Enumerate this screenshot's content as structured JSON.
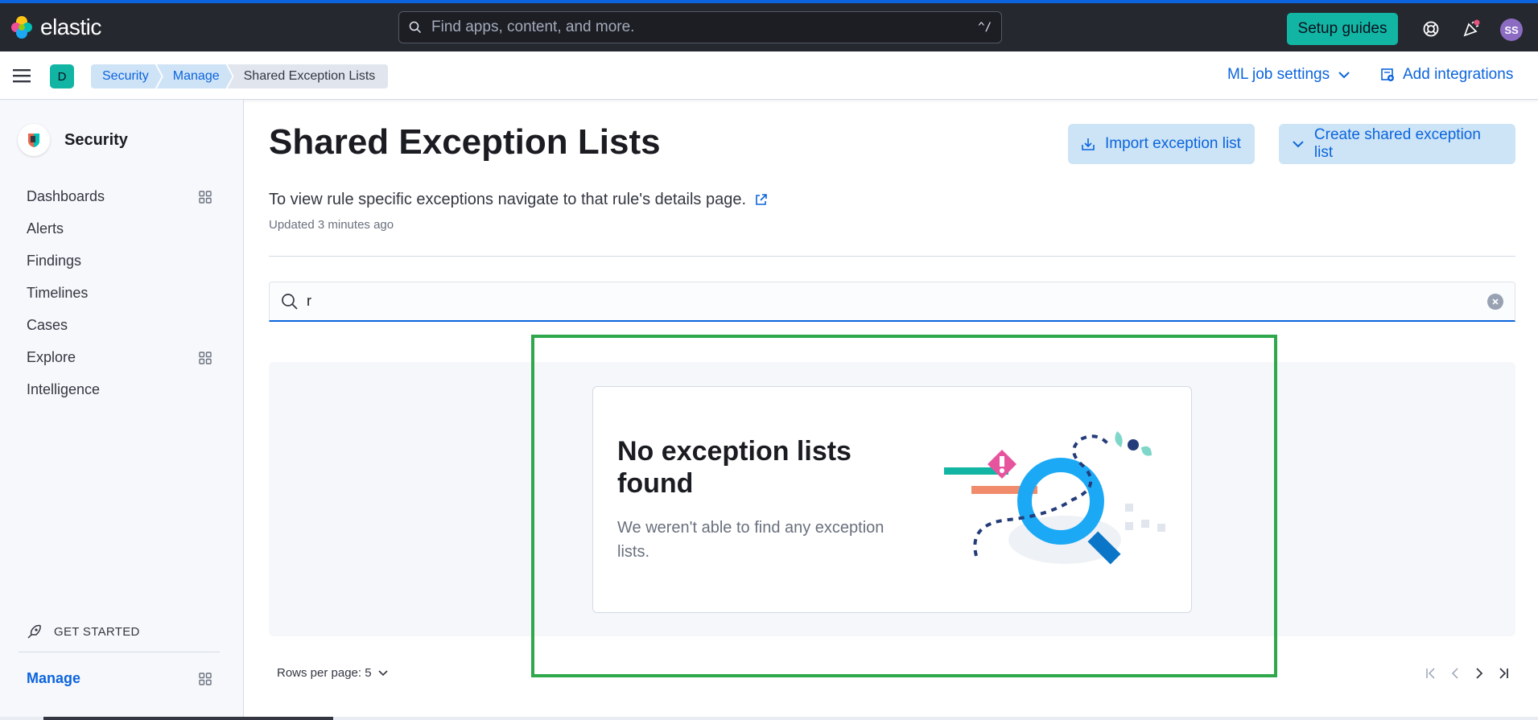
{
  "app": {
    "name": "elastic"
  },
  "header": {
    "search_placeholder": "Find apps, content, and more.",
    "search_shortcut": "^/",
    "setup_guides": "Setup guides",
    "user_initials": "SS"
  },
  "subheader": {
    "space_initial": "D",
    "breadcrumbs": [
      "Security",
      "Manage",
      "Shared Exception Lists"
    ],
    "ml_job_settings": "ML job settings",
    "add_integrations": "Add integrations"
  },
  "sidebar": {
    "title": "Security",
    "items": [
      {
        "label": "Dashboards",
        "has_grid_icon": true
      },
      {
        "label": "Alerts",
        "has_grid_icon": false
      },
      {
        "label": "Findings",
        "has_grid_icon": false
      },
      {
        "label": "Timelines",
        "has_grid_icon": false
      },
      {
        "label": "Cases",
        "has_grid_icon": false
      },
      {
        "label": "Explore",
        "has_grid_icon": true
      },
      {
        "label": "Intelligence",
        "has_grid_icon": false
      }
    ],
    "get_started": "GET STARTED",
    "manage": "Manage"
  },
  "main": {
    "title": "Shared Exception Lists",
    "import_button": "Import exception list",
    "create_button": "Create shared exception list",
    "description": "To view rule specific exceptions navigate to that rule's details page.",
    "updated": "Updated 3 minutes ago",
    "search_value": "r",
    "empty_title": "No exception lists found",
    "empty_body": "We weren't able to find any exception lists.",
    "rows_per_page": "Rows per page: 5"
  },
  "colors": {
    "accent": "#0b64dd",
    "header_bg": "#25282f",
    "setup_button": "#12b5a3",
    "highlight_box": "#2ea84a"
  }
}
